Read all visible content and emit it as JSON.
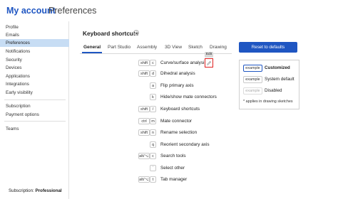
{
  "header": {
    "title": "My account",
    "subtitle": "Preferences"
  },
  "sidebar": {
    "items": [
      {
        "label": "Profile"
      },
      {
        "label": "Emails"
      },
      {
        "label": "Preferences",
        "active": true
      },
      {
        "label": "Notifications"
      },
      {
        "label": "Security"
      },
      {
        "label": "Devices"
      },
      {
        "label": "Applications"
      },
      {
        "label": "Integrations"
      },
      {
        "label": "Early visibility"
      }
    ],
    "billing": [
      {
        "label": "Subscription"
      },
      {
        "label": "Payment options"
      }
    ],
    "teams": {
      "label": "Teams"
    },
    "subscription": {
      "prefix": "Subscription:",
      "value": "Professional"
    }
  },
  "main": {
    "title": "Keyboard shortcuts",
    "help_icon": "question-icon",
    "tabs": [
      "General",
      "Part Studio",
      "Assembly",
      "3D View",
      "Sketch",
      "Drawing"
    ],
    "active_tab": "General",
    "reset_label": "Reset to defaults",
    "edit_tooltip": "Edit",
    "shortcuts": [
      {
        "mod": "shift",
        "key": "c",
        "action": "Curve/surface analysis"
      },
      {
        "mod": "shift",
        "key": "d",
        "action": "Dihedral analysis"
      },
      {
        "mod": "",
        "key": "a",
        "action": "Flip primary axis"
      },
      {
        "mod": "",
        "key": "k",
        "action": "Hide/show mate connectors"
      },
      {
        "mod": "shift",
        "key": "/",
        "action": "Keyboard shortcuts"
      },
      {
        "mod": "ctrl",
        "key": "m",
        "action": "Mate connector"
      },
      {
        "mod": "shift",
        "key": "n",
        "action": "Rename selection"
      },
      {
        "mod": "",
        "key": "q",
        "action": "Reorient secondary axis"
      },
      {
        "mod": "alt/⌥",
        "key": "c",
        "action": "Search tools"
      },
      {
        "mod": "",
        "key": "`",
        "action": "Select other"
      },
      {
        "mod": "alt/⌥",
        "key": "t",
        "action": "Tab manager"
      }
    ]
  },
  "legend": {
    "items": [
      {
        "key": "example",
        "label": "Customized",
        "style": "customized"
      },
      {
        "key": "example",
        "label": "System default",
        "style": "default"
      },
      {
        "key": "example",
        "label": "Disabled",
        "style": "disabled"
      }
    ],
    "note": "* applies in drawing sketches"
  },
  "colors": {
    "accent": "#1f56c2",
    "active_nav": "#c7ddf4",
    "edit_highlight": "#e02020"
  }
}
